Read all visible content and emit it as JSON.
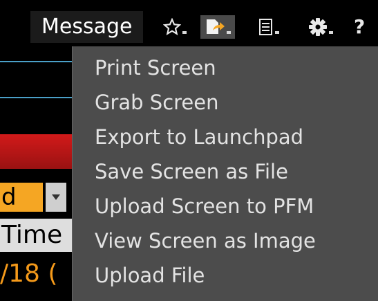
{
  "toolbar": {
    "message_label": "Message",
    "icons": [
      "star-icon",
      "export-icon",
      "document-icon",
      "gear-icon",
      "help-icon"
    ],
    "help_label": "?"
  },
  "background": {
    "field_value": "d",
    "time_header": "Time",
    "date_fragment": "/18 ("
  },
  "menu": {
    "items": [
      "Print Screen",
      "Grab Screen",
      "Export to Launchpad",
      "Save Screen as File",
      "Upload Screen to PFM",
      "View Screen as Image",
      "Upload File"
    ]
  },
  "colors": {
    "accent_blue": "#4aa0c8",
    "alert_red": "#d21a1a",
    "field_orange": "#f5a623",
    "menu_bg": "#4c4c4c"
  }
}
